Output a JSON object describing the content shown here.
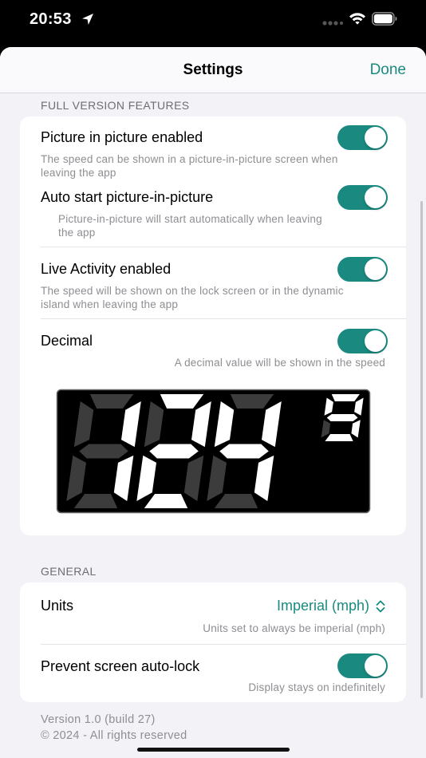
{
  "status_bar": {
    "time": "20:53"
  },
  "nav": {
    "title": "Settings",
    "done_label": "Done"
  },
  "colors": {
    "accent": "#1a8a80",
    "toggle_on": "#1a8a80",
    "background": "#f2f2f7"
  },
  "full_version": {
    "header": "FULL VERSION FEATURES",
    "pip": {
      "title": "Picture in picture enabled",
      "subtitle_line1": "The speed can be shown in a picture-in-picture screen when",
      "subtitle_line2": "leaving the app",
      "enabled": true
    },
    "auto_pip": {
      "title": "Auto start picture-in-picture",
      "subtitle_line1": "Picture-in-picture will start automatically when leaving",
      "subtitle_line2": "the app",
      "enabled": true
    },
    "live_activity": {
      "title": "Live Activity enabled",
      "subtitle_line1": "The speed will be shown on the lock screen or in the dynamic",
      "subtitle_line2": "island when leaving the app",
      "enabled": true
    },
    "decimal": {
      "title": "Decimal",
      "subtitle": "A decimal value will be shown in the speed",
      "enabled": true
    },
    "speed_preview": {
      "main_digits": "124",
      "decimal_digit": "9"
    }
  },
  "general": {
    "header": "GENERAL",
    "units": {
      "title": "Units",
      "value": "Imperial (mph)",
      "subtitle": "Units set to always be imperial (mph)",
      "icon": "chevron-up-down-icon"
    },
    "prevent_lock": {
      "title": "Prevent screen auto-lock",
      "subtitle": "Display stays on indefinitely",
      "enabled": true
    }
  },
  "footer": {
    "version": "Version 1.0 (build 27)",
    "copyright": "© 2024 - All rights reserved"
  }
}
